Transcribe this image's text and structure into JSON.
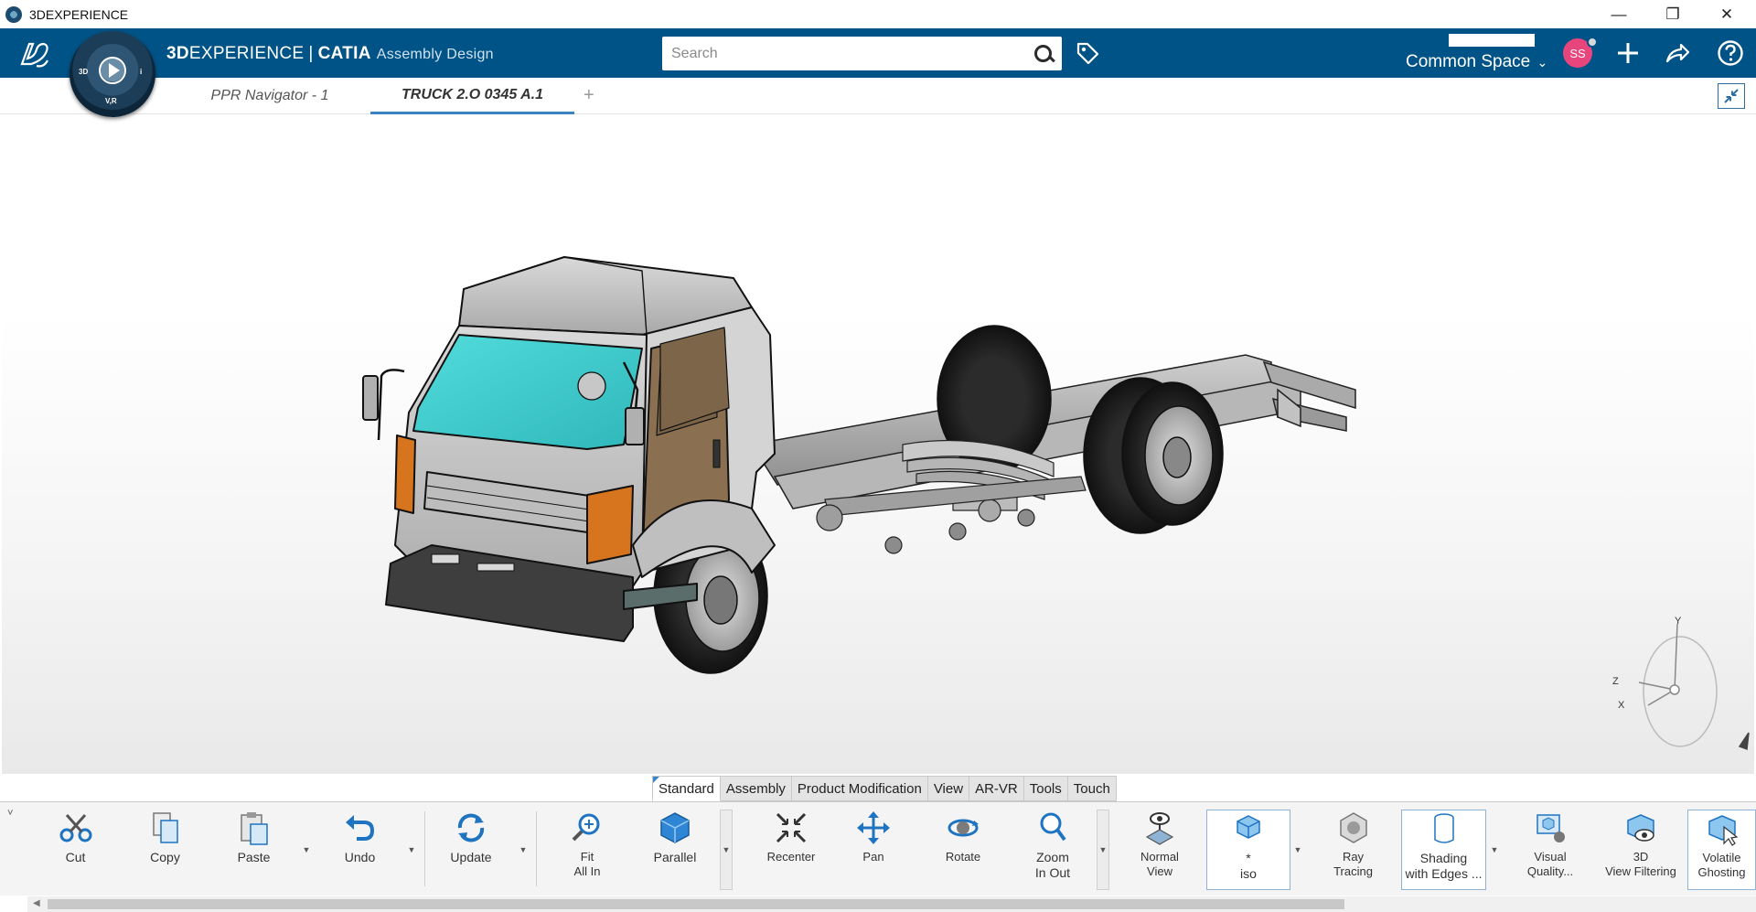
{
  "window": {
    "title": "3DEXPERIENCE",
    "controls": [
      "—",
      "❐",
      "✕"
    ]
  },
  "topbar": {
    "logo": "3DS",
    "compass": {
      "top": "",
      "left": "3D",
      "right": "i",
      "bottom": "V,R"
    },
    "brand_bold": "3D",
    "brand_rest": "EXPERIENCE",
    "brand_sep": "|",
    "brand_app": "CATIA",
    "brand_sub": "Assembly Design",
    "search_placeholder": "Search",
    "space_label": "Common Space",
    "avatar_initials": "SS"
  },
  "tabs": [
    {
      "label": "PPR Navigator - 1",
      "active": false
    },
    {
      "label": "TRUCK 2.O 0345 A.1",
      "active": true
    }
  ],
  "tab_add": "+",
  "section_tabs": [
    {
      "label": "Standard",
      "active": true
    },
    {
      "label": "Assembly",
      "active": false
    },
    {
      "label": "Product Modification",
      "active": false
    },
    {
      "label": "View",
      "active": false
    },
    {
      "label": "AR-VR",
      "active": false
    },
    {
      "label": "Tools",
      "active": false
    },
    {
      "label": "Touch",
      "active": false
    }
  ],
  "compass_axes": {
    "y": "Y",
    "z": "Z",
    "x": "X"
  },
  "ribbon": {
    "expander": "˅",
    "commands": {
      "cut": "Cut",
      "copy": "Copy",
      "paste": "Paste",
      "undo": "Undo",
      "update": "Update",
      "fit_all_in_1": "Fit",
      "fit_all_in_2": "All In",
      "parallel": "Parallel",
      "recenter": "Recenter",
      "pan": "Pan",
      "rotate": "Rotate",
      "zoom_1": "Zoom",
      "zoom_2": "In Out",
      "normal_view_1": "Normal",
      "normal_view_2": "View",
      "iso_1": "*",
      "iso_2": "iso",
      "ray_tracing_1": "Ray",
      "ray_tracing_2": "Tracing",
      "shading_1": "Shading",
      "shading_2": "with Edges ...",
      "visual_quality_1": "Visual",
      "visual_quality_2": "Quality...",
      "view_filtering_1": "3D",
      "view_filtering_2": "View Filtering",
      "volatile_1": "Volatile",
      "volatile_2": "Ghosting"
    }
  },
  "colors": {
    "topbar": "#005386",
    "accent": "#3b84c4",
    "windshield": "#3cc8c8",
    "door": "#8a7050",
    "lamp": "#d7751f"
  }
}
